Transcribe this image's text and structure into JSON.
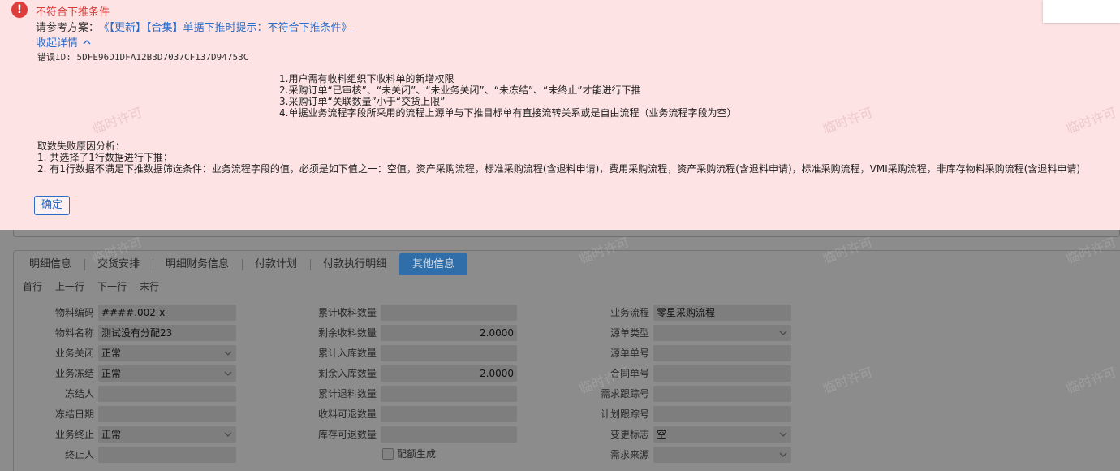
{
  "error": {
    "title": "不符合下推条件",
    "ref_label": "请参考方案：",
    "ref_link": "《【更新】【合集】单据下推时提示：不符合下推条件》",
    "collapse_label": "收起详情",
    "error_id": "错误ID: 5DFE96D1DFA12B3D7037CF137D94753C",
    "rules": [
      "1.用户需有收料组织下收料单的新增权限",
      "2.采购订单“已审核”、“未关闭”、“未业务关闭”、“未冻结”、“未终止”才能进行下推",
      "3.采购订单“关联数量”小于“交货上限”",
      "4.单据业务流程字段所采用的流程上源单与下推目标单有直接流转关系或是自由流程（业务流程字段为空）"
    ],
    "analysis_title": "取数失败原因分析：",
    "analysis": [
      "1. 共选择了1行数据进行下推；",
      "2. 有1行数据不满足下推数据筛选条件：业务流程字段的值，必须是如下值之一：空值，资产采购流程，标准采购流程(含退料申请)，费用采购流程，资产采购流程(含退料申请)，标准采购流程，VMI采购流程，非库存物料采购流程(含退料申请)"
    ],
    "ok_label": "确定"
  },
  "watermark": "临时许可",
  "tabs": [
    "明细信息",
    "交货安排",
    "明细财务信息",
    "付款计划",
    "付款执行明细",
    "其他信息"
  ],
  "active_tab": "其他信息",
  "rownav": [
    "首行",
    "上一行",
    "下一行",
    "末行"
  ],
  "col1": [
    {
      "label": "物料编码",
      "value": "####.002-x",
      "select": false
    },
    {
      "label": "物料名称",
      "value": "测试没有分配23",
      "select": false
    },
    {
      "label": "业务关闭",
      "value": "正常",
      "select": true
    },
    {
      "label": "业务冻结",
      "value": "正常",
      "select": true
    },
    {
      "label": "冻结人",
      "value": "",
      "select": false
    },
    {
      "label": "冻结日期",
      "value": "",
      "select": false
    },
    {
      "label": "业务终止",
      "value": "正常",
      "select": true
    },
    {
      "label": "终止人",
      "value": "",
      "select": false
    }
  ],
  "col2": [
    {
      "label": "累计收料数量",
      "value": ""
    },
    {
      "label": "剩余收料数量",
      "value": "2.0000"
    },
    {
      "label": "累计入库数量",
      "value": ""
    },
    {
      "label": "剩余入库数量",
      "value": "2.0000"
    },
    {
      "label": "累计退料数量",
      "value": ""
    },
    {
      "label": "收料可退数量",
      "value": ""
    },
    {
      "label": "库存可退数量",
      "value": ""
    }
  ],
  "checkbox_label": "配额生成",
  "col3": [
    {
      "label": "业务流程",
      "value": "零星采购流程",
      "select": false
    },
    {
      "label": "源单类型",
      "value": "",
      "select": true
    },
    {
      "label": "源单单号",
      "value": "",
      "select": false
    },
    {
      "label": "合同单号",
      "value": "",
      "select": false
    },
    {
      "label": "需求跟踪号",
      "value": "",
      "select": false
    },
    {
      "label": "计划跟踪号",
      "value": "",
      "select": false
    },
    {
      "label": "变更标志",
      "value": "空",
      "select": true
    },
    {
      "label": "需求来源",
      "value": "",
      "select": true
    }
  ]
}
